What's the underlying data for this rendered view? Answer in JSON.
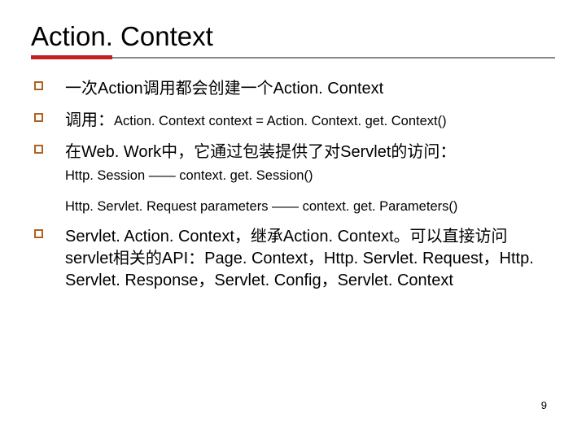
{
  "slide": {
    "title": "Action. Context",
    "page_number": "9"
  },
  "bullets": {
    "b1": {
      "text": "一次Action调用都会创建一个Action. Context"
    },
    "b2": {
      "prefix_cjk": "调用：",
      "latin": "Action. Context context = Action. Context. get. Context()"
    },
    "b3": {
      "text_cjk_a": "在Web. Work中，它通过包装提供了对Servlet的访问：",
      "sub1": "Http. Session —— context. get. Session()",
      "sub2": "Http. Servlet. Request parameters —— context. get. Parameters()"
    },
    "b4": {
      "text": "Servlet. Action. Context，继承Action. Context。可以直接访问servlet相关的API：Page. Context，Http. Servlet. Request，Http. Servlet. Response，Servlet. Config，Servlet. Context"
    }
  }
}
